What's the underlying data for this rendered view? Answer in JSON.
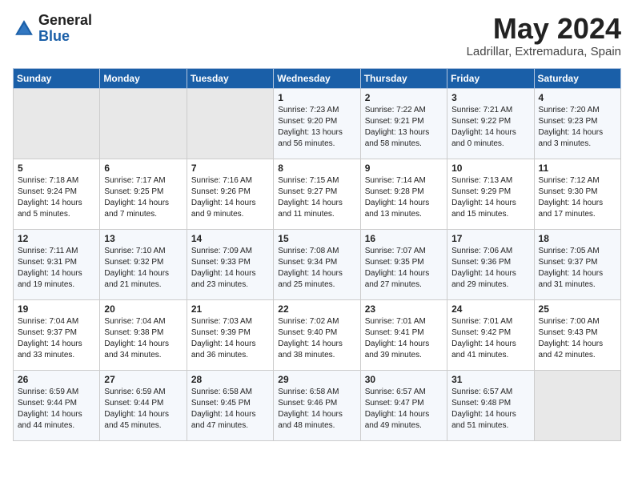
{
  "logo": {
    "general": "General",
    "blue": "Blue"
  },
  "title": "May 2024",
  "location": "Ladrillar, Extremadura, Spain",
  "days_of_week": [
    "Sunday",
    "Monday",
    "Tuesday",
    "Wednesday",
    "Thursday",
    "Friday",
    "Saturday"
  ],
  "weeks": [
    [
      {
        "day": "",
        "empty": true
      },
      {
        "day": "",
        "empty": true
      },
      {
        "day": "",
        "empty": true
      },
      {
        "day": "1",
        "sunrise": "7:23 AM",
        "sunset": "9:20 PM",
        "daylight": "13 hours and 56 minutes."
      },
      {
        "day": "2",
        "sunrise": "7:22 AM",
        "sunset": "9:21 PM",
        "daylight": "13 hours and 58 minutes."
      },
      {
        "day": "3",
        "sunrise": "7:21 AM",
        "sunset": "9:22 PM",
        "daylight": "14 hours and 0 minutes."
      },
      {
        "day": "4",
        "sunrise": "7:20 AM",
        "sunset": "9:23 PM",
        "daylight": "14 hours and 3 minutes."
      }
    ],
    [
      {
        "day": "5",
        "sunrise": "7:18 AM",
        "sunset": "9:24 PM",
        "daylight": "14 hours and 5 minutes."
      },
      {
        "day": "6",
        "sunrise": "7:17 AM",
        "sunset": "9:25 PM",
        "daylight": "14 hours and 7 minutes."
      },
      {
        "day": "7",
        "sunrise": "7:16 AM",
        "sunset": "9:26 PM",
        "daylight": "14 hours and 9 minutes."
      },
      {
        "day": "8",
        "sunrise": "7:15 AM",
        "sunset": "9:27 PM",
        "daylight": "14 hours and 11 minutes."
      },
      {
        "day": "9",
        "sunrise": "7:14 AM",
        "sunset": "9:28 PM",
        "daylight": "14 hours and 13 minutes."
      },
      {
        "day": "10",
        "sunrise": "7:13 AM",
        "sunset": "9:29 PM",
        "daylight": "14 hours and 15 minutes."
      },
      {
        "day": "11",
        "sunrise": "7:12 AM",
        "sunset": "9:30 PM",
        "daylight": "14 hours and 17 minutes."
      }
    ],
    [
      {
        "day": "12",
        "sunrise": "7:11 AM",
        "sunset": "9:31 PM",
        "daylight": "14 hours and 19 minutes."
      },
      {
        "day": "13",
        "sunrise": "7:10 AM",
        "sunset": "9:32 PM",
        "daylight": "14 hours and 21 minutes."
      },
      {
        "day": "14",
        "sunrise": "7:09 AM",
        "sunset": "9:33 PM",
        "daylight": "14 hours and 23 minutes."
      },
      {
        "day": "15",
        "sunrise": "7:08 AM",
        "sunset": "9:34 PM",
        "daylight": "14 hours and 25 minutes."
      },
      {
        "day": "16",
        "sunrise": "7:07 AM",
        "sunset": "9:35 PM",
        "daylight": "14 hours and 27 minutes."
      },
      {
        "day": "17",
        "sunrise": "7:06 AM",
        "sunset": "9:36 PM",
        "daylight": "14 hours and 29 minutes."
      },
      {
        "day": "18",
        "sunrise": "7:05 AM",
        "sunset": "9:37 PM",
        "daylight": "14 hours and 31 minutes."
      }
    ],
    [
      {
        "day": "19",
        "sunrise": "7:04 AM",
        "sunset": "9:37 PM",
        "daylight": "14 hours and 33 minutes."
      },
      {
        "day": "20",
        "sunrise": "7:04 AM",
        "sunset": "9:38 PM",
        "daylight": "14 hours and 34 minutes."
      },
      {
        "day": "21",
        "sunrise": "7:03 AM",
        "sunset": "9:39 PM",
        "daylight": "14 hours and 36 minutes."
      },
      {
        "day": "22",
        "sunrise": "7:02 AM",
        "sunset": "9:40 PM",
        "daylight": "14 hours and 38 minutes."
      },
      {
        "day": "23",
        "sunrise": "7:01 AM",
        "sunset": "9:41 PM",
        "daylight": "14 hours and 39 minutes."
      },
      {
        "day": "24",
        "sunrise": "7:01 AM",
        "sunset": "9:42 PM",
        "daylight": "14 hours and 41 minutes."
      },
      {
        "day": "25",
        "sunrise": "7:00 AM",
        "sunset": "9:43 PM",
        "daylight": "14 hours and 42 minutes."
      }
    ],
    [
      {
        "day": "26",
        "sunrise": "6:59 AM",
        "sunset": "9:44 PM",
        "daylight": "14 hours and 44 minutes."
      },
      {
        "day": "27",
        "sunrise": "6:59 AM",
        "sunset": "9:44 PM",
        "daylight": "14 hours and 45 minutes."
      },
      {
        "day": "28",
        "sunrise": "6:58 AM",
        "sunset": "9:45 PM",
        "daylight": "14 hours and 47 minutes."
      },
      {
        "day": "29",
        "sunrise": "6:58 AM",
        "sunset": "9:46 PM",
        "daylight": "14 hours and 48 minutes."
      },
      {
        "day": "30",
        "sunrise": "6:57 AM",
        "sunset": "9:47 PM",
        "daylight": "14 hours and 49 minutes."
      },
      {
        "day": "31",
        "sunrise": "6:57 AM",
        "sunset": "9:48 PM",
        "daylight": "14 hours and 51 minutes."
      },
      {
        "day": "",
        "empty": true
      }
    ]
  ]
}
